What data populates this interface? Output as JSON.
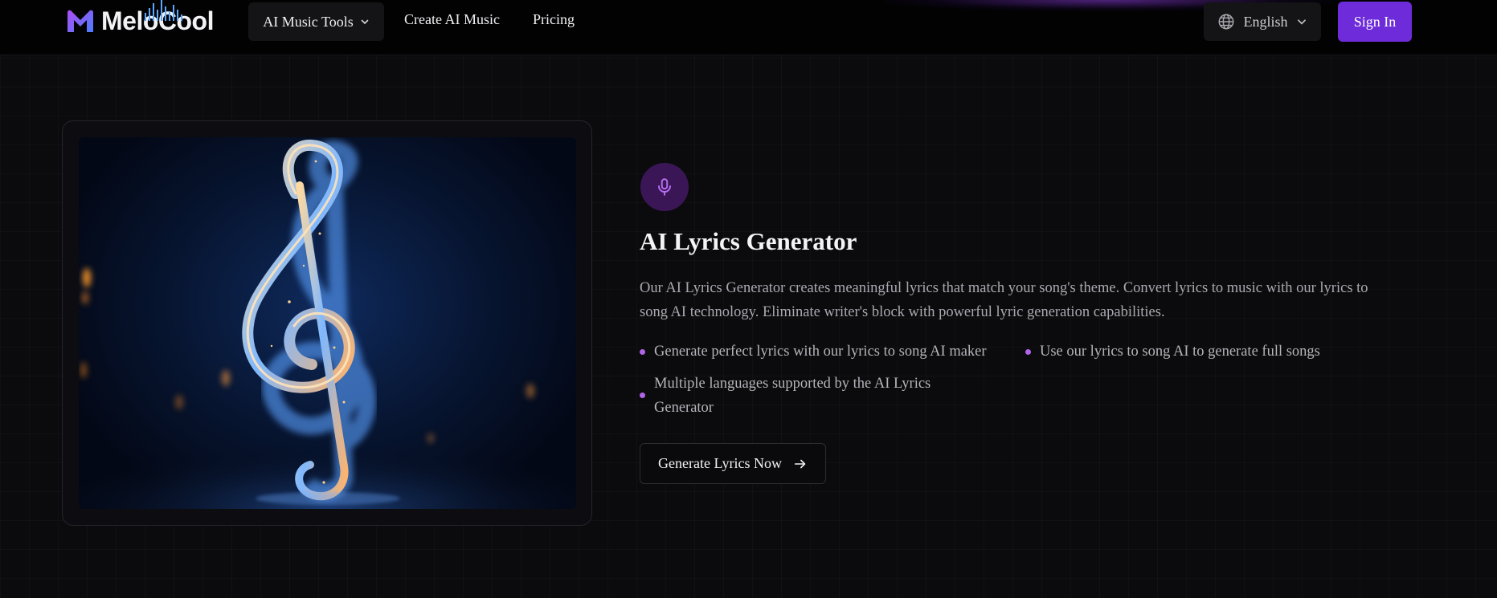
{
  "header": {
    "logo_text": "MeloCool",
    "nav": {
      "tools_label": "AI Music Tools",
      "create_label": "Create AI Music",
      "pricing_label": "Pricing"
    },
    "language_label": "English",
    "signin_label": "Sign In"
  },
  "feature_section": {
    "icon": "microphone-icon",
    "title": "AI Lyrics Generator",
    "description": "Our AI Lyrics Generator creates meaningful lyrics that match your song's theme. Convert lyrics to music with our lyrics to song AI technology. Eliminate writer's block with powerful lyric generation capabilities.",
    "features": [
      "Generate perfect lyrics with our lyrics to song AI maker",
      "Use our lyrics to song AI to generate full songs",
      "Multiple languages supported by the AI Lyrics Generator"
    ],
    "cta_label": "Generate Lyrics Now",
    "image": "glowing-treble-clef"
  },
  "colors": {
    "accent": "#6d2bd9",
    "bullet": "#b264e8",
    "mic_badge_bg": "#3a1656",
    "background": "#0b0b0d"
  }
}
